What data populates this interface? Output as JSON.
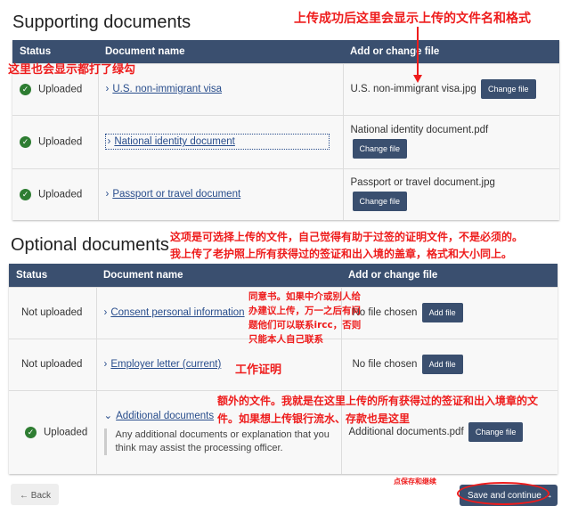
{
  "supporting": {
    "title": "Supporting documents",
    "headers": [
      "Status",
      "Document name",
      "Add or change file"
    ],
    "rows": [
      {
        "status": "Uploaded",
        "doc": "U.S. non-immigrant visa",
        "file": "U.S. non-immigrant visa.jpg",
        "btn": "Change file"
      },
      {
        "status": "Uploaded",
        "doc": "National identity document",
        "file": "National identity document.pdf",
        "btn": "Change file"
      },
      {
        "status": "Uploaded",
        "doc": "Passport or travel document",
        "file": "Passport or travel document.jpg",
        "btn": "Change file"
      }
    ]
  },
  "optional": {
    "title": "Optional documents",
    "headers": [
      "Status",
      "Document name",
      "Add or change file"
    ],
    "rows": [
      {
        "status": "Not uploaded",
        "doc": "Consent personal information",
        "file": "No file chosen",
        "btn": "Add file"
      },
      {
        "status": "Not uploaded",
        "doc": "Employer letter (current)",
        "file": "No file chosen",
        "btn": "Add file"
      },
      {
        "status": "Uploaded",
        "doc": "Additional documents",
        "detail": "Any additional documents or explanation that you think may assist the processing officer.",
        "file": "Additional documents.pdf",
        "btn": "Change file"
      }
    ]
  },
  "footer": {
    "back": "Back",
    "save": "Save and continue"
  },
  "annotations": {
    "a1": "上传成功后这里会显示上传的文件名和格式",
    "a2": "这里也会显示都打了绿勾",
    "a3": "这项是可选择上传的文件，自己觉得有助于过签的证明文件，不是必须的。",
    "a4": "我上传了老护照上所有获得过的签证和出入境的盖章，格式和大小同上。",
    "a5": "同意书。如果中介或别人给办建议上传，万一之后有问题他们可以联系ircc，否则只能本人自己联系",
    "a6": "工作证明",
    "a7": "额外的文件。我就是在这里上传的所有获得过的签证和出入境章的文件。如果想上传银行流水、存款也是这里",
    "a8": "点保存和继续"
  },
  "colors": {
    "header": "#3a4f6f",
    "annotation": "#ee1c1c",
    "success": "#2e7d32"
  }
}
